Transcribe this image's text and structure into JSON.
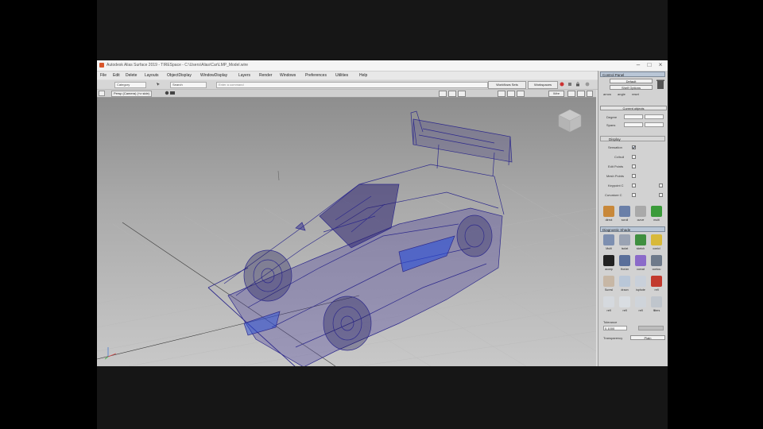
{
  "window": {
    "title": "Autodesk Alias Surface 2019  -  TIRESpace - C:\\Users\\Alias\\Car\\LMP_Model.wire",
    "minimize": "–",
    "maximize": "□",
    "close": "×"
  },
  "menu": {
    "items": [
      "File",
      "Edit",
      "Delete",
      "Layouts",
      "ObjectDisplay",
      "WindowDisplay",
      "Layers",
      "Render",
      "Windows",
      "Preferences",
      "Utilities",
      "Help"
    ]
  },
  "toolbar": {
    "category_value": "Category",
    "search_value": "Search",
    "command_placeholder": "Enter a command",
    "workspace_button": "Workflows Sets",
    "workspaces_button": "Workspaces"
  },
  "viewport": {
    "label": "Persp (Camera) (+z side)",
    "shade_button": "Wire"
  },
  "control_panel": {
    "header": "Control Panel",
    "layer_value": "Default",
    "shelf_value": "Shelf Options",
    "shelf_tabs": [
      "arrow",
      "angle",
      "reset"
    ],
    "section_header": "Current objects",
    "degree_label": "Degree",
    "spans_label": "Spans",
    "display_header": "Display",
    "toggles": [
      {
        "label": "Sensation",
        "checked": true
      },
      {
        "label": "Cv/hull",
        "checked": false
      },
      {
        "label": "Edit Points",
        "checked": false
      },
      {
        "label": "Mesh Points",
        "checked": false
      },
      {
        "label": "Keypoint C",
        "checked": false
      },
      {
        "label": "Curvature C",
        "checked": false
      }
    ],
    "tools_row1": [
      {
        "label": "direct",
        "color": "#c8883a"
      },
      {
        "label": "scroll",
        "color": "#6a7fa8"
      },
      {
        "label": "curve",
        "color": "#a9a9a9"
      },
      {
        "label": "multi",
        "color": "#3b9b3a"
      }
    ],
    "diagnostic_header": "Diagnostic Shade",
    "diagnostic_tools": [
      {
        "label": "Multi",
        "color": "#7d8fb0"
      },
      {
        "label": "isolat",
        "color": "#9aa3b3"
      },
      {
        "label": "sketch",
        "color": "#3f8f3f"
      },
      {
        "label": "conicl",
        "color": "#d8b93a"
      },
      {
        "label": "accep",
        "color": "#222222"
      },
      {
        "label": "Horizn",
        "color": "#5a6f9a"
      },
      {
        "label": "curvat",
        "color": "#8b6bc9"
      },
      {
        "label": "contou",
        "color": "#6e7a8a"
      },
      {
        "label": "Suresl",
        "color": "#c7b7a5"
      },
      {
        "label": "draon",
        "color": "#b9c7d8"
      },
      {
        "label": "isphote",
        "color": "#c9d0da"
      },
      {
        "label": "refl",
        "color": "#c23a2e"
      },
      {
        "label": "refl",
        "color": "#d5d9de"
      },
      {
        "label": "refl",
        "color": "#d9dde2"
      },
      {
        "label": "refl",
        "color": "#cfd4da"
      },
      {
        "label": "filters",
        "color": "#bfc5cc"
      }
    ],
    "tolerance_label": "Tolerance",
    "tolerance_value": "0.1000",
    "transparency_label": "Transparency",
    "transparency_value": "Plain"
  }
}
